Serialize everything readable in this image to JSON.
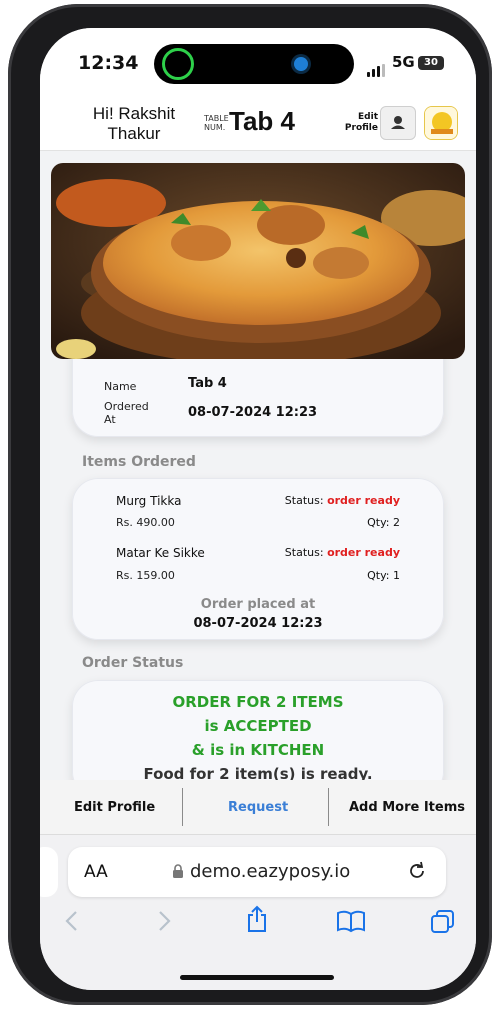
{
  "status_bar": {
    "time": "12:34",
    "network": "5G",
    "battery": "30"
  },
  "app_header": {
    "greeting": "Hi! Rakshit Thakur",
    "table_label": "TABLE NUM.",
    "table_number": "Tab 4",
    "edit_profile_label": "Edit Profile"
  },
  "hero_image": {
    "alt": "Biryani dish"
  },
  "order_info": {
    "name_label": "Name",
    "name_value": "Tab 4",
    "ordered_at_label": "Ordered At",
    "ordered_at_value": "08-07-2024 12:23"
  },
  "items_section": {
    "title": "Items Ordered",
    "items": [
      {
        "name": "Murg Tikka",
        "price": "Rs. 490.00",
        "status_label": "Status:",
        "status": "order ready",
        "qty": "Qty: 2"
      },
      {
        "name": "Matar Ke Sikke",
        "price": "Rs. 159.00",
        "status_label": "Status:",
        "status": "order ready",
        "qty": "Qty: 1"
      }
    ],
    "placed_label": "Order placed at",
    "placed_value": "08-07-2024 12:23"
  },
  "order_status": {
    "title": "Order Status",
    "line1": "ORDER FOR 2 ITEMS",
    "line2": "is ACCEPTED",
    "line3": "& is in KITCHEN",
    "line4": "Food for 2 item(s) is ready."
  },
  "bottom_nav": {
    "edit_profile": "Edit Profile",
    "request": "Request",
    "add_more": "Add More Items"
  },
  "browser": {
    "aa_label": "AA",
    "url": "demo.eazyposy.io"
  },
  "colors": {
    "accent_green": "#2aa02a",
    "status_red": "#e02020",
    "request_blue": "#3b7fd6",
    "ios_blue": "#1a73e8"
  }
}
